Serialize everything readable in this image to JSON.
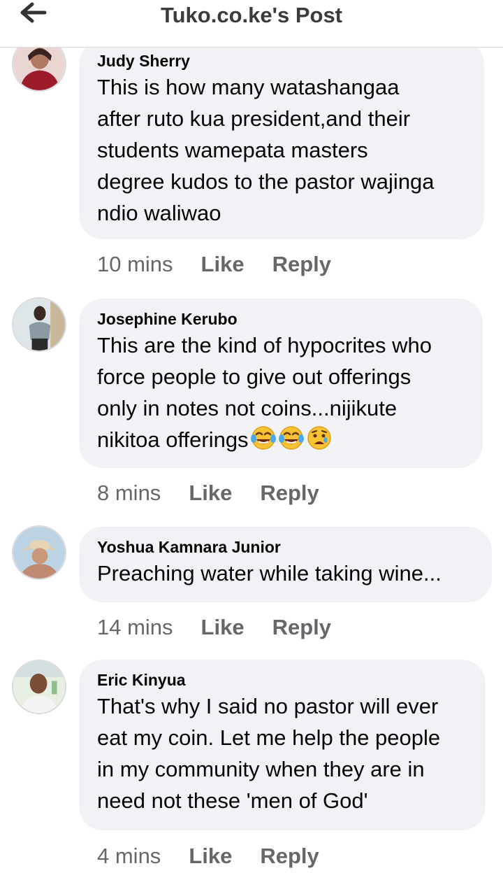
{
  "header": {
    "title": "Tuko.co.ke's Post"
  },
  "comments": [
    {
      "author": "Judy Sherry",
      "text": "This is how many watashangaa\nafter ruto kua president,and their\nstudents wamepata masters\ndegree kudos to the pastor wajinga\nndio waliwao",
      "time": "10 mins",
      "like": "Like",
      "reply": "Reply"
    },
    {
      "author": "Josephine Kerubo",
      "text": "This are the kind of hypocrites who\nforce people to give out offerings\nonly in notes not coins...nijikute\nnikitoa offerings",
      "emojis": [
        "tears-of-joy-icon",
        "tears-of-joy-icon",
        "anguished-face-icon"
      ],
      "time": "8 mins",
      "like": "Like",
      "reply": "Reply"
    },
    {
      "author": "Yoshua Kamnara Junior",
      "text": "Preaching water while taking wine...",
      "time": "14 mins",
      "like": "Like",
      "reply": "Reply"
    },
    {
      "author": "Eric Kinyua",
      "text": "That's why I said no pastor will ever\neat my coin. Let me help the people\nin my community when they are in\nneed not these 'men of God'",
      "time": "4 mins",
      "like": "Like",
      "reply": "Reply"
    }
  ],
  "colors": {
    "bubble": "#f0f2f5",
    "meta_text": "#65676b",
    "body_text": "#050505"
  }
}
